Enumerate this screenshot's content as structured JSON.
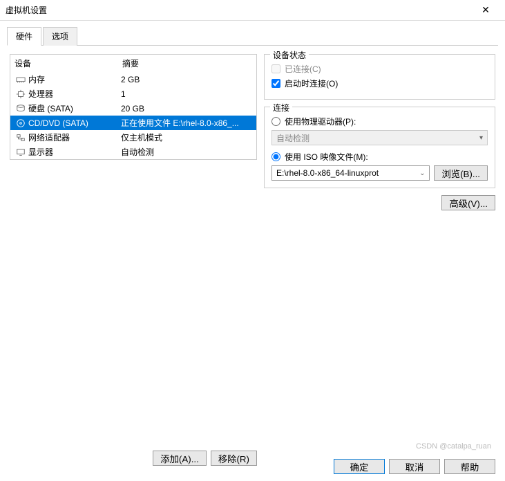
{
  "window": {
    "title": "虚拟机设置"
  },
  "tabs": {
    "hardware": "硬件",
    "options": "选项"
  },
  "table": {
    "h_device": "设备",
    "h_summary": "摘要",
    "rows": [
      {
        "name": "内存",
        "summary": "2 GB",
        "icon": "memory"
      },
      {
        "name": "处理器",
        "summary": "1",
        "icon": "cpu"
      },
      {
        "name": "硬盘 (SATA)",
        "summary": "20 GB",
        "icon": "disk"
      },
      {
        "name": "CD/DVD (SATA)",
        "summary": "正在使用文件 E:\\rhel-8.0-x86_...",
        "icon": "cd"
      },
      {
        "name": "网络适配器",
        "summary": "仅主机模式",
        "icon": "net"
      },
      {
        "name": "显示器",
        "summary": "自动检测",
        "icon": "display"
      }
    ]
  },
  "status": {
    "group": "设备状态",
    "connected": "已连接(C)",
    "connect_on": "启动时连接(O)"
  },
  "conn": {
    "group": "连接",
    "use_physical": "使用物理驱动器(P):",
    "auto_detect": "自动检测",
    "use_iso": "使用 ISO 映像文件(M):",
    "iso_path": "E:\\rhel-8.0-x86_64-linuxprot",
    "browse": "浏览(B)..."
  },
  "buttons": {
    "advanced": "高级(V)...",
    "add": "添加(A)...",
    "remove": "移除(R)",
    "ok": "确定",
    "cancel": "取消",
    "help": "帮助"
  },
  "watermark": "CSDN @catalpa_ruan"
}
